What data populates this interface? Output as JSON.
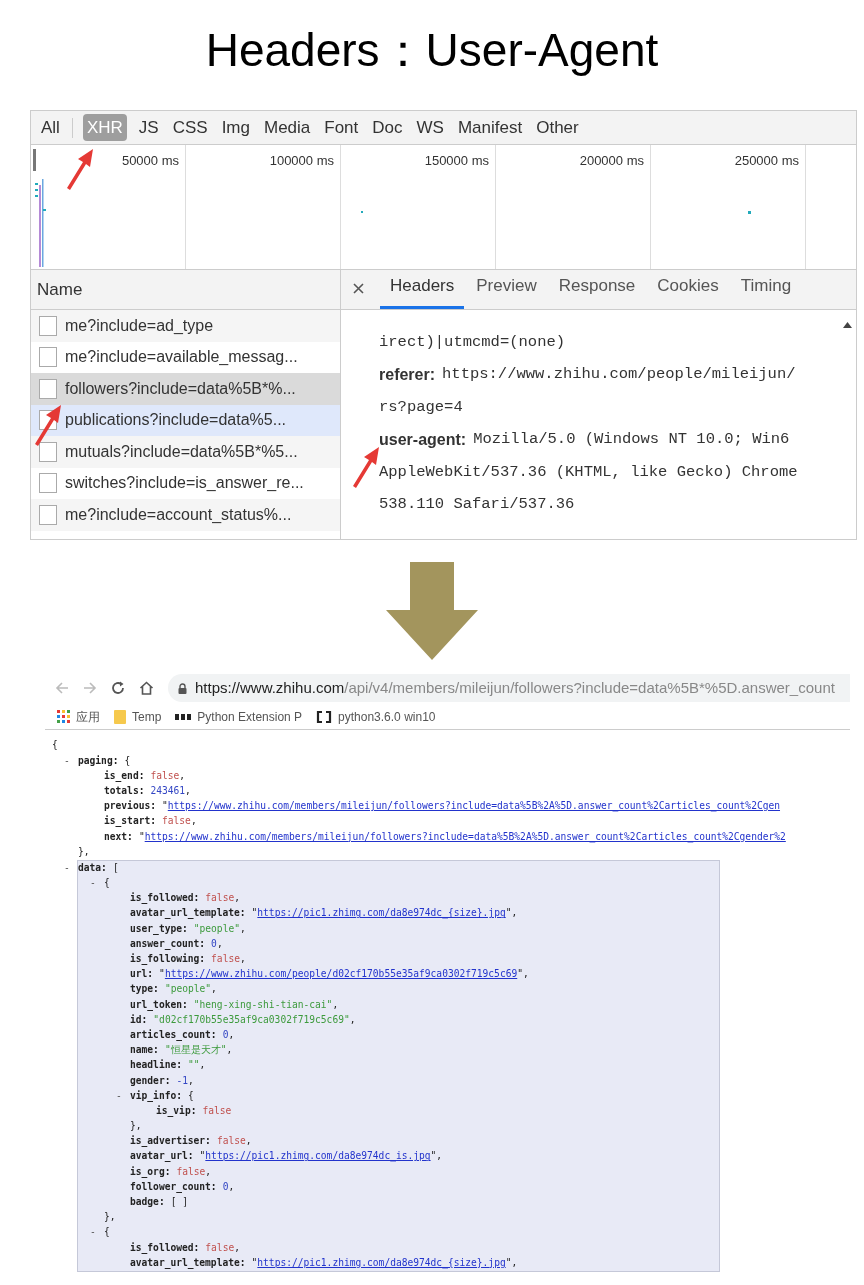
{
  "title": "Headers：User-Agent",
  "devtools": {
    "filters": [
      {
        "label": "All",
        "selected": false
      },
      {
        "label": "XHR",
        "selected": true
      },
      {
        "label": "JS",
        "selected": false
      },
      {
        "label": "CSS",
        "selected": false
      },
      {
        "label": "Img",
        "selected": false
      },
      {
        "label": "Media",
        "selected": false
      },
      {
        "label": "Font",
        "selected": false
      },
      {
        "label": "Doc",
        "selected": false
      },
      {
        "label": "WS",
        "selected": false
      },
      {
        "label": "Manifest",
        "selected": false
      },
      {
        "label": "Other",
        "selected": false
      }
    ],
    "timeline_ticks": [
      "50000 ms",
      "100000 ms",
      "150000 ms",
      "200000 ms",
      "250000 ms"
    ],
    "name_header": "Name",
    "requests": [
      {
        "name": "me?include=ad_type",
        "selected": false,
        "hovered": false
      },
      {
        "name": "me?include=available_messag...",
        "selected": false,
        "hovered": false
      },
      {
        "name": "followers?include=data%5B*%...",
        "selected": true,
        "hovered": false
      },
      {
        "name": "publications?include=data%5...",
        "selected": false,
        "hovered": true
      },
      {
        "name": "mutuals?include=data%5B*%5...",
        "selected": false,
        "hovered": false
      },
      {
        "name": "switches?include=is_answer_re...",
        "selected": false,
        "hovered": false
      },
      {
        "name": "me?include=account_status%...",
        "selected": false,
        "hovered": false
      }
    ],
    "tabs": [
      {
        "label": "Headers",
        "selected": true
      },
      {
        "label": "Preview",
        "selected": false
      },
      {
        "label": "Response",
        "selected": false
      },
      {
        "label": "Cookies",
        "selected": false
      },
      {
        "label": "Timing",
        "selected": false
      }
    ],
    "header_lines": [
      {
        "value": "irect)|utmcmd=(none)"
      },
      {
        "key": "referer:",
        "value": "https://www.zhihu.com/people/mileijun/"
      },
      {
        "value": "rs?page=4"
      },
      {
        "key": "user-agent:",
        "value": "Mozilla/5.0 (Windows NT 10.0; Win6"
      },
      {
        "value": "AppleWebKit/537.36 (KHTML, like Gecko) Chrome"
      },
      {
        "value": "538.110 Safari/537.36"
      }
    ]
  },
  "browser": {
    "url_host": "https://www.zhihu.com",
    "url_path": "/api/v4/members/mileijun/followers?include=data%5B*%5D.answer_count",
    "bookmarks": [
      {
        "kind": "apps",
        "label": "应用"
      },
      {
        "kind": "folder",
        "label": "Temp"
      },
      {
        "kind": "lfd",
        "label": "Python Extension P"
      },
      {
        "kind": "brackets",
        "label": "python3.6.0 win10"
      }
    ],
    "json": {
      "open": "{",
      "children": [
        {
          "toggle": "-",
          "key": "paging:",
          "open": "{",
          "highlighted": false,
          "close": "},",
          "children": [
            {
              "key": "is_end:",
              "value": "false",
              "kind": "boolean",
              "after": ","
            },
            {
              "key": "totals:",
              "value": "243461",
              "kind": "number",
              "after": ","
            },
            {
              "key": "previous:",
              "before": "\"",
              "value": "https://www.zhihu.com/members/mileijun/followers?include=data%5B%2A%5D.answer_count%2Carticles_count%2Cgen",
              "kind": "link"
            },
            {
              "key": "is_start:",
              "value": "false",
              "kind": "boolean",
              "after": ","
            },
            {
              "key": "next:",
              "before": "\"",
              "value": "https://www.zhihu.com/members/mileijun/followers?include=data%5B%2A%5D.answer_count%2Carticles_count%2Cgender%2",
              "kind": "link"
            }
          ]
        },
        {
          "toggle": "-",
          "key": "data:",
          "open": "[",
          "highlighted": true,
          "children": [
            {
              "toggle": "-",
              "open": "{",
              "highlighted": false,
              "close": "},",
              "children": [
                {
                  "key": "is_followed:",
                  "value": "false",
                  "kind": "boolean",
                  "after": ","
                },
                {
                  "key": "avatar_url_template:",
                  "before": "\"",
                  "value": "https://pic1.zhimg.com/da8e974dc_{size}.jpg",
                  "kind": "link",
                  "after": "\","
                },
                {
                  "key": "user_type:",
                  "value": "\"people\"",
                  "kind": "string",
                  "after": ","
                },
                {
                  "key": "answer_count:",
                  "value": "0",
                  "kind": "number",
                  "after": ","
                },
                {
                  "key": "is_following:",
                  "value": "false",
                  "kind": "boolean",
                  "after": ","
                },
                {
                  "key": "url:",
                  "before": "\"",
                  "value": "https://www.zhihu.com/people/d02cf170b55e35af9ca0302f719c5c69",
                  "kind": "link",
                  "after": "\","
                },
                {
                  "key": "type:",
                  "value": "\"people\"",
                  "kind": "string",
                  "after": ","
                },
                {
                  "key": "url_token:",
                  "value": "\"heng-xing-shi-tian-cai\"",
                  "kind": "string",
                  "after": ","
                },
                {
                  "key": "id:",
                  "value": "\"d02cf170b55e35af9ca0302f719c5c69\"",
                  "kind": "string",
                  "after": ","
                },
                {
                  "key": "articles_count:",
                  "value": "0",
                  "kind": "number",
                  "after": ","
                },
                {
                  "key": "name:",
                  "value": "\"恒星是天才\"",
                  "kind": "string",
                  "after": ","
                },
                {
                  "key": "headline:",
                  "value": "\"\"",
                  "kind": "string",
                  "after": ","
                },
                {
                  "key": "gender:",
                  "value": "-1",
                  "kind": "number",
                  "after": ","
                },
                {
                  "toggle": "-",
                  "key": "vip_info:",
                  "open": "{",
                  "highlighted": false,
                  "close": "},",
                  "children": [
                    {
                      "key": "is_vip:",
                      "value": "false",
                      "kind": "boolean"
                    }
                  ]
                },
                {
                  "key": "is_advertiser:",
                  "value": "false",
                  "kind": "boolean",
                  "after": ","
                },
                {
                  "key": "avatar_url:",
                  "before": "\"",
                  "value": "https://pic1.zhimg.com/da8e974dc_is.jpg",
                  "kind": "link",
                  "after": "\","
                },
                {
                  "key": "is_org:",
                  "value": "false",
                  "kind": "boolean",
                  "after": ","
                },
                {
                  "key": "follower_count:",
                  "value": "0",
                  "kind": "number",
                  "after": ","
                },
                {
                  "key": "badge:",
                  "value": "[ ]",
                  "kind": "plain"
                }
              ]
            },
            {
              "toggle": "-",
              "open": "{",
              "highlighted": false,
              "children": [
                {
                  "key": "is_followed:",
                  "value": "false",
                  "kind": "boolean",
                  "after": ","
                },
                {
                  "key": "avatar_url_template:",
                  "before": "\"",
                  "value": "https://pic1.zhimg.com/da8e974dc_{size}.jpg",
                  "kind": "link",
                  "after": "\","
                }
              ]
            }
          ]
        }
      ]
    }
  }
}
